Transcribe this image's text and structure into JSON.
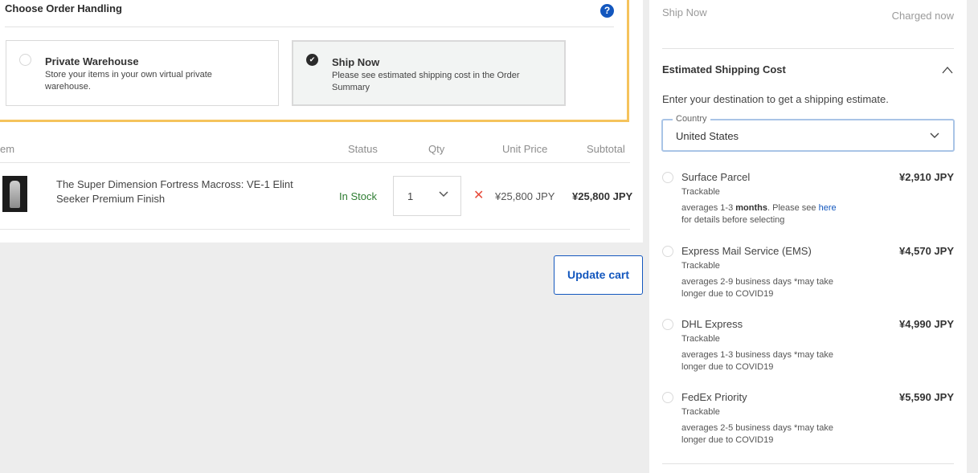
{
  "handling": {
    "title": "Choose Order Handling",
    "help": "?",
    "options": [
      {
        "title": "Private Warehouse",
        "desc": "Store your items in your own virtual private warehouse.",
        "selected": false
      },
      {
        "title": "Ship Now",
        "desc": "Please see estimated shipping cost in the Order Summary",
        "selected": true
      }
    ]
  },
  "cart": {
    "headers": {
      "item": "em",
      "status": "Status",
      "qty": "Qty",
      "unit_price": "Unit Price",
      "subtotal": "Subtotal"
    },
    "item": {
      "name": "The Super Dimension Fortress Macross: VE-1 Elint Seeker Premium Finish",
      "status": "In Stock",
      "qty": "1",
      "remove": "✕",
      "unit_price": "¥25,800 JPY",
      "subtotal": "¥25,800 JPY"
    },
    "update_label": "Update cart"
  },
  "summary": {
    "ship_now": "Ship Now",
    "charged_now": "Charged now",
    "est_title": "Estimated Shipping Cost",
    "intro": "Enter your destination to get a shipping estimate.",
    "country_label": "Country",
    "country_value": "United States",
    "methods": [
      {
        "name": "Surface Parcel",
        "price": "¥2,910 JPY",
        "track": "Trackable",
        "desc_pre": "averages 1-3 ",
        "desc_bold": "months",
        "desc_mid": ". Please see ",
        "desc_link": "here",
        "desc_post": " for details before selecting"
      },
      {
        "name": "Express Mail Service (EMS)",
        "price": "¥4,570 JPY",
        "track": "Trackable",
        "desc": "averages 2-9 business days *may take longer due to COVID19"
      },
      {
        "name": "DHL Express",
        "price": "¥4,990 JPY",
        "track": "Trackable",
        "desc": "averages 1-3 business days *may take longer due to COVID19"
      },
      {
        "name": "FedEx Priority",
        "price": "¥5,590 JPY",
        "track": "Trackable",
        "desc": "averages 2-5 business days *may take longer due to COVID19"
      }
    ]
  },
  "colors": {
    "accent": "#1357be",
    "highlight": "#f5c35c",
    "stock": "#2e7d32",
    "remove": "#e74c3c"
  }
}
